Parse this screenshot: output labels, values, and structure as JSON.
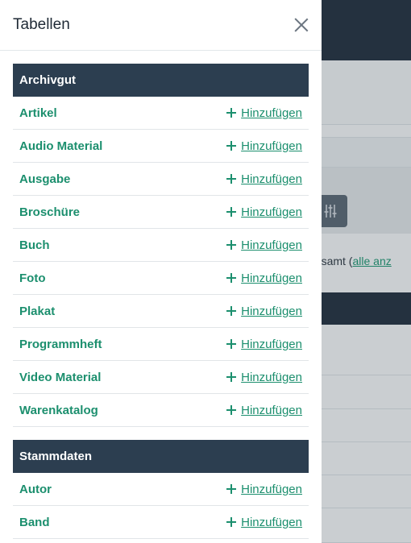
{
  "drawer": {
    "title": "Tabellen",
    "close_icon": "close-icon",
    "add_label": "Hinzufügen",
    "sections": [
      {
        "title": "Archivgut",
        "items": [
          "Artikel",
          "Audio Material",
          "Ausgabe",
          "Broschüre",
          "Buch",
          "Foto",
          "Plakat",
          "Programmheft",
          "Video Material",
          "Warenkatalog"
        ]
      },
      {
        "title": "Stammdaten",
        "items": [
          "Autor",
          "Band"
        ]
      }
    ]
  },
  "background": {
    "count_text_prefix": "gesamt (",
    "count_link": "alle anz",
    "filter_icon": "sliders-icon"
  },
  "colors": {
    "accent": "#1c8f6e",
    "section_header": "#2c3e50",
    "topbar": "#1f2d3c"
  }
}
